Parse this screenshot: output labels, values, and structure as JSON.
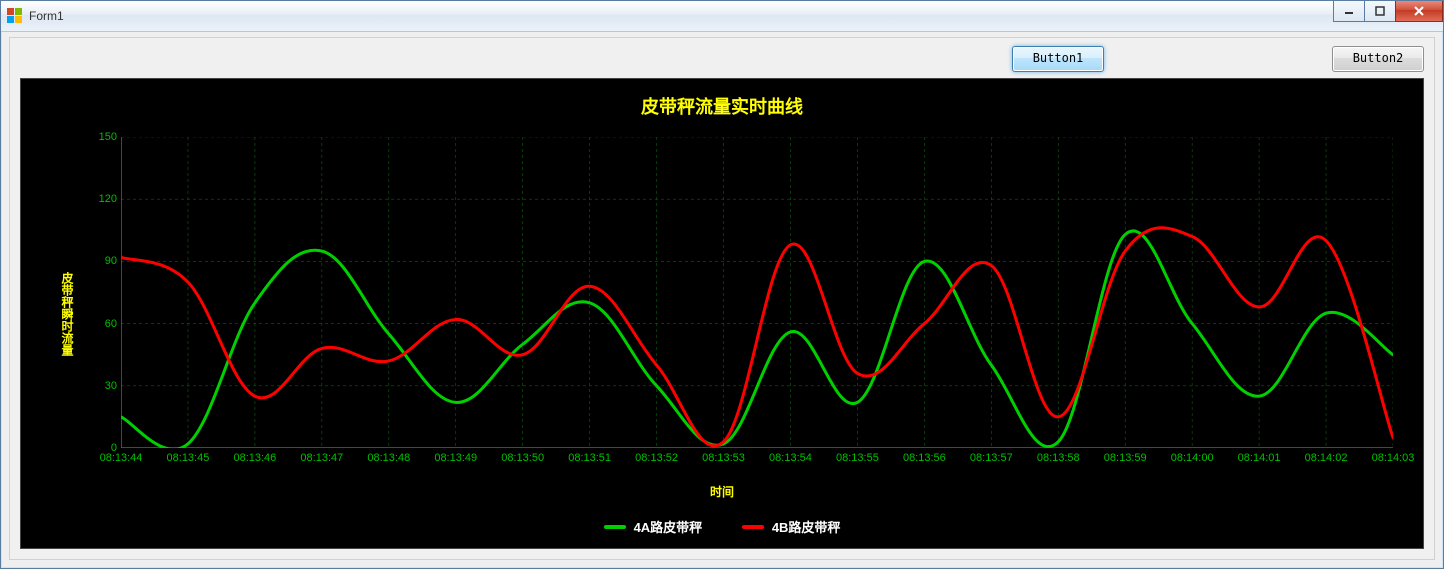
{
  "window": {
    "title": "Form1"
  },
  "buttons": {
    "btn1": "Button1",
    "btn2": "Button2"
  },
  "colors": {
    "seriesA": "#00d000",
    "seriesB": "#ff0000",
    "grid": "#006600",
    "axis": "#00a000",
    "title": "#ffff00",
    "tick": "#00c000",
    "bg": "#000000",
    "legendText": "#ffffff"
  },
  "chart_data": {
    "type": "line",
    "title": "皮带秤流量实时曲线",
    "xlabel": "时间",
    "ylabel": "皮带秤瞬时流量",
    "ylim": [
      0,
      150
    ],
    "yticks": [
      0,
      30,
      60,
      90,
      120,
      150
    ],
    "categories": [
      "08:13:44",
      "08:13:45",
      "08:13:46",
      "08:13:47",
      "08:13:48",
      "08:13:49",
      "08:13:50",
      "08:13:51",
      "08:13:52",
      "08:13:53",
      "08:13:54",
      "08:13:55",
      "08:13:56",
      "08:13:57",
      "08:13:58",
      "08:13:59",
      "08:14:00",
      "08:14:01",
      "08:14:02",
      "08:14:03"
    ],
    "series": [
      {
        "name": "4A路皮带秤",
        "color": "#00d000",
        "values": [
          15,
          2,
          70,
          95,
          55,
          22,
          50,
          70,
          30,
          2,
          56,
          22,
          90,
          40,
          3,
          103,
          60,
          25,
          65,
          45
        ]
      },
      {
        "name": "4B路皮带秤",
        "color": "#ff0000",
        "values": [
          92,
          80,
          25,
          48,
          42,
          62,
          45,
          78,
          40,
          3,
          98,
          36,
          60,
          88,
          15,
          95,
          102,
          68,
          100,
          5
        ]
      }
    ],
    "legend_position": "bottom",
    "grid": true
  }
}
